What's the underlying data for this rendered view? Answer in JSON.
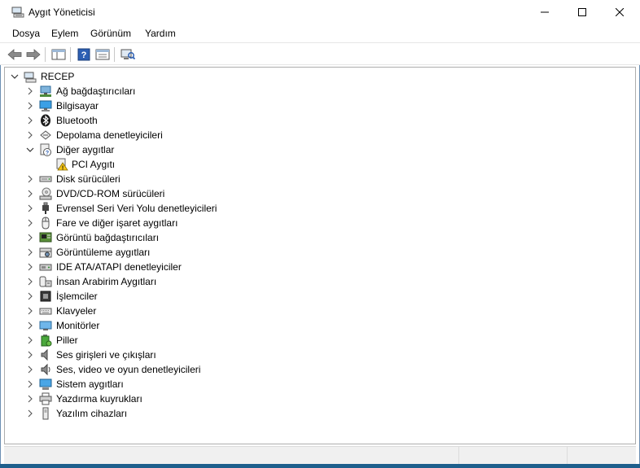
{
  "window": {
    "title": "Aygıt Yöneticisi",
    "icon": "device-manager-icon",
    "controls": [
      "minimize-icon",
      "maximize-icon",
      "close-icon"
    ]
  },
  "menu": [
    "Dosya",
    "Eylem",
    "Görünüm",
    "Yardım"
  ],
  "toolbar": {
    "buttons": [
      "back-arrow-icon",
      "forward-arrow-icon",
      "show-hide-console-tree-icon",
      "help-icon",
      "properties-icon",
      "scan-hardware-icon"
    ]
  },
  "tree": {
    "root": {
      "label": "RECEP",
      "expanded": true,
      "icon": "computer-icon"
    },
    "items": [
      {
        "label": "Ağ bağdaştırıcıları",
        "icon": "network-adapter-icon",
        "expanded": false
      },
      {
        "label": "Bilgisayar",
        "icon": "computer-icon",
        "expanded": false
      },
      {
        "label": "Bluetooth",
        "icon": "bluetooth-icon",
        "expanded": false
      },
      {
        "label": "Depolama denetleyicileri",
        "icon": "storage-controller-icon",
        "expanded": false
      },
      {
        "label": "Diğer aygıtlar",
        "icon": "unknown-device-icon",
        "expanded": true,
        "children": [
          {
            "label": "PCI Aygıtı",
            "icon": "warning-device-icon"
          }
        ]
      },
      {
        "label": "Disk sürücüleri",
        "icon": "disk-drive-icon",
        "expanded": false
      },
      {
        "label": "DVD/CD-ROM sürücüleri",
        "icon": "dvd-drive-icon",
        "expanded": false
      },
      {
        "label": "Evrensel Seri Veri Yolu denetleyicileri",
        "icon": "usb-icon",
        "expanded": false
      },
      {
        "label": "Fare ve diğer işaret aygıtları",
        "icon": "mouse-icon",
        "expanded": false
      },
      {
        "label": "Görüntü bağdaştırıcıları",
        "icon": "display-adapter-icon",
        "expanded": false
      },
      {
        "label": "Görüntüleme aygıtları",
        "icon": "imaging-device-icon",
        "expanded": false
      },
      {
        "label": "IDE ATA/ATAPI denetleyiciler",
        "icon": "ide-controller-icon",
        "expanded": false
      },
      {
        "label": "İnsan Arabirim Aygıtları",
        "icon": "hid-icon",
        "expanded": false
      },
      {
        "label": "İşlemciler",
        "icon": "processor-icon",
        "expanded": false
      },
      {
        "label": "Klavyeler",
        "icon": "keyboard-icon",
        "expanded": false
      },
      {
        "label": "Monitörler",
        "icon": "monitor-icon",
        "expanded": false
      },
      {
        "label": "Piller",
        "icon": "battery-icon",
        "expanded": false
      },
      {
        "label": "Ses girişleri ve çıkışları",
        "icon": "speaker-icon",
        "expanded": false
      },
      {
        "label": "Ses, video ve oyun denetleyicileri",
        "icon": "sound-controller-icon",
        "expanded": false
      },
      {
        "label": "Sistem aygıtları",
        "icon": "system-device-icon",
        "expanded": false
      },
      {
        "label": "Yazdırma kuyrukları",
        "icon": "printer-icon",
        "expanded": false
      },
      {
        "label": "Yazılım cihazları",
        "icon": "software-device-icon",
        "expanded": false
      }
    ]
  },
  "colors": {
    "accent": "#1e5f8c",
    "tree_border": "#adadad"
  }
}
